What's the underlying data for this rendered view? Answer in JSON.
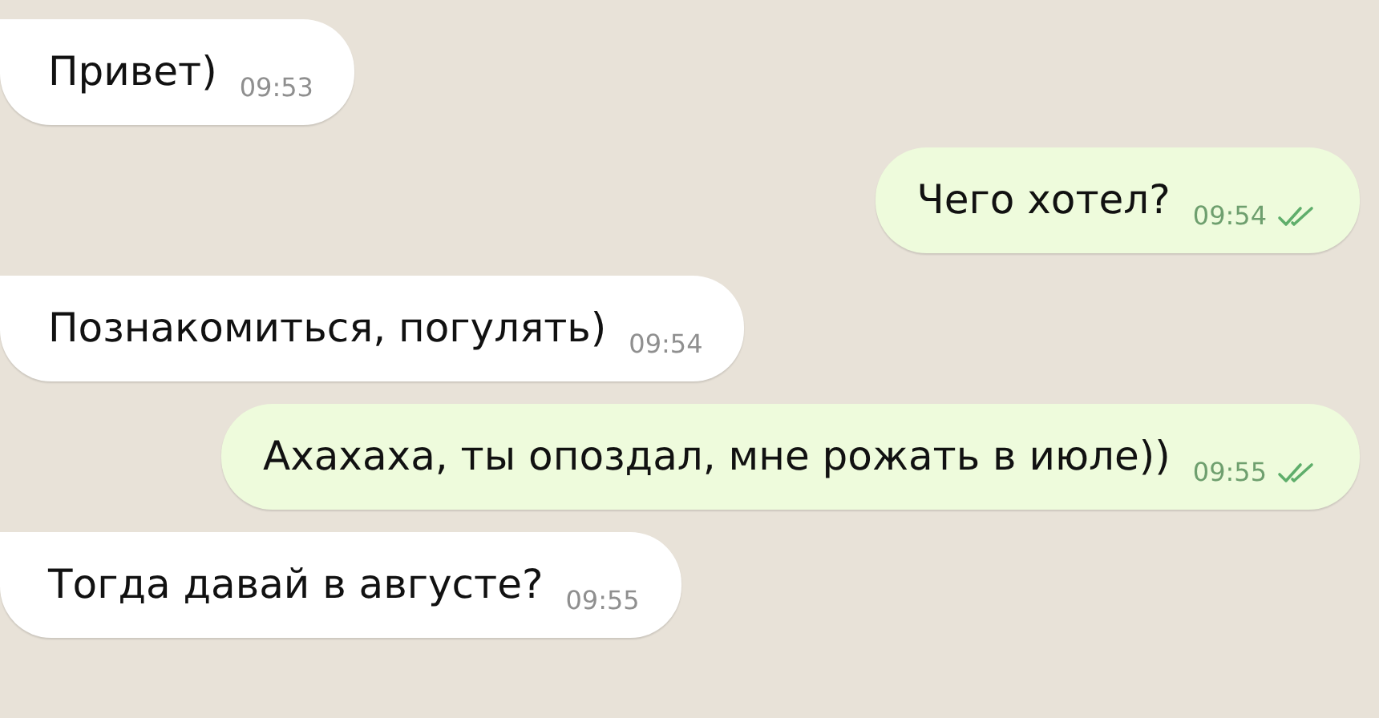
{
  "messages": [
    {
      "kind": "in",
      "text": "Привет)",
      "time": "09:53"
    },
    {
      "kind": "out",
      "text": "Чего хотел?",
      "time": "09:54",
      "read": true
    },
    {
      "kind": "in",
      "text": "Познакомиться, погулять)",
      "time": "09:54"
    },
    {
      "kind": "out",
      "text": "Ахахаха, ты опоздал, мне рожать в июле))",
      "time": "09:55",
      "read": true
    },
    {
      "kind": "in",
      "text": "Тогда давай в августе?",
      "time": "09:55"
    }
  ]
}
